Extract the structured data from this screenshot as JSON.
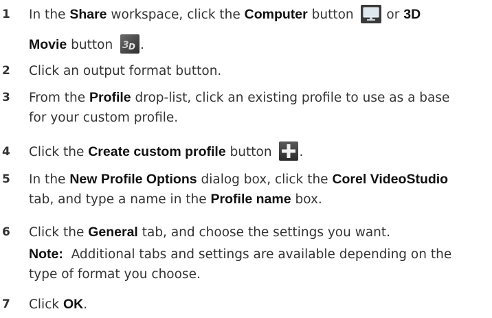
{
  "steps": [
    {
      "number": "1",
      "line1": {
        "t1": "In the ",
        "b1": "Share",
        "t2": " workspace, click the ",
        "b2": "Computer",
        "t3": " button ",
        "t4": " or ",
        "b3": "3D"
      },
      "line2": {
        "b1": "Movie",
        "t1": " button ",
        "t2": "."
      }
    },
    {
      "number": "2",
      "text": "Click an output format button."
    },
    {
      "number": "3",
      "line1": {
        "t1": "From the ",
        "b1": "Profile",
        "t2": " drop-list, click an existing profile to use as a base"
      },
      "line2": {
        "t1": "for your custom profile."
      }
    },
    {
      "number": "4",
      "t1": "Click the ",
      "b1": "Create custom profile",
      "t2": " button ",
      "t3": "."
    },
    {
      "number": "5",
      "line1": {
        "t1": "In the ",
        "b1": "New Profile Options",
        "t2": " dialog box, click the ",
        "b2": "Corel VideoStudio"
      },
      "line2": {
        "t1": "tab, and type a name in the ",
        "b1": "Profile name",
        "t2": " box."
      }
    },
    {
      "number": "6",
      "line1": {
        "t1": "Click the ",
        "b1": "General",
        "t2": " tab, and choose the settings you want."
      },
      "note": {
        "label": "Note:",
        "t1": "  Additional tabs and settings are available depending on the",
        "t2": "type of format you choose."
      }
    },
    {
      "number": "7",
      "t1": "Click ",
      "b1": "OK",
      "t2": "."
    }
  ],
  "icons": {
    "computer": "computer-monitor-icon",
    "movie3d": "3d-movie-icon",
    "plus": "plus-icon"
  }
}
